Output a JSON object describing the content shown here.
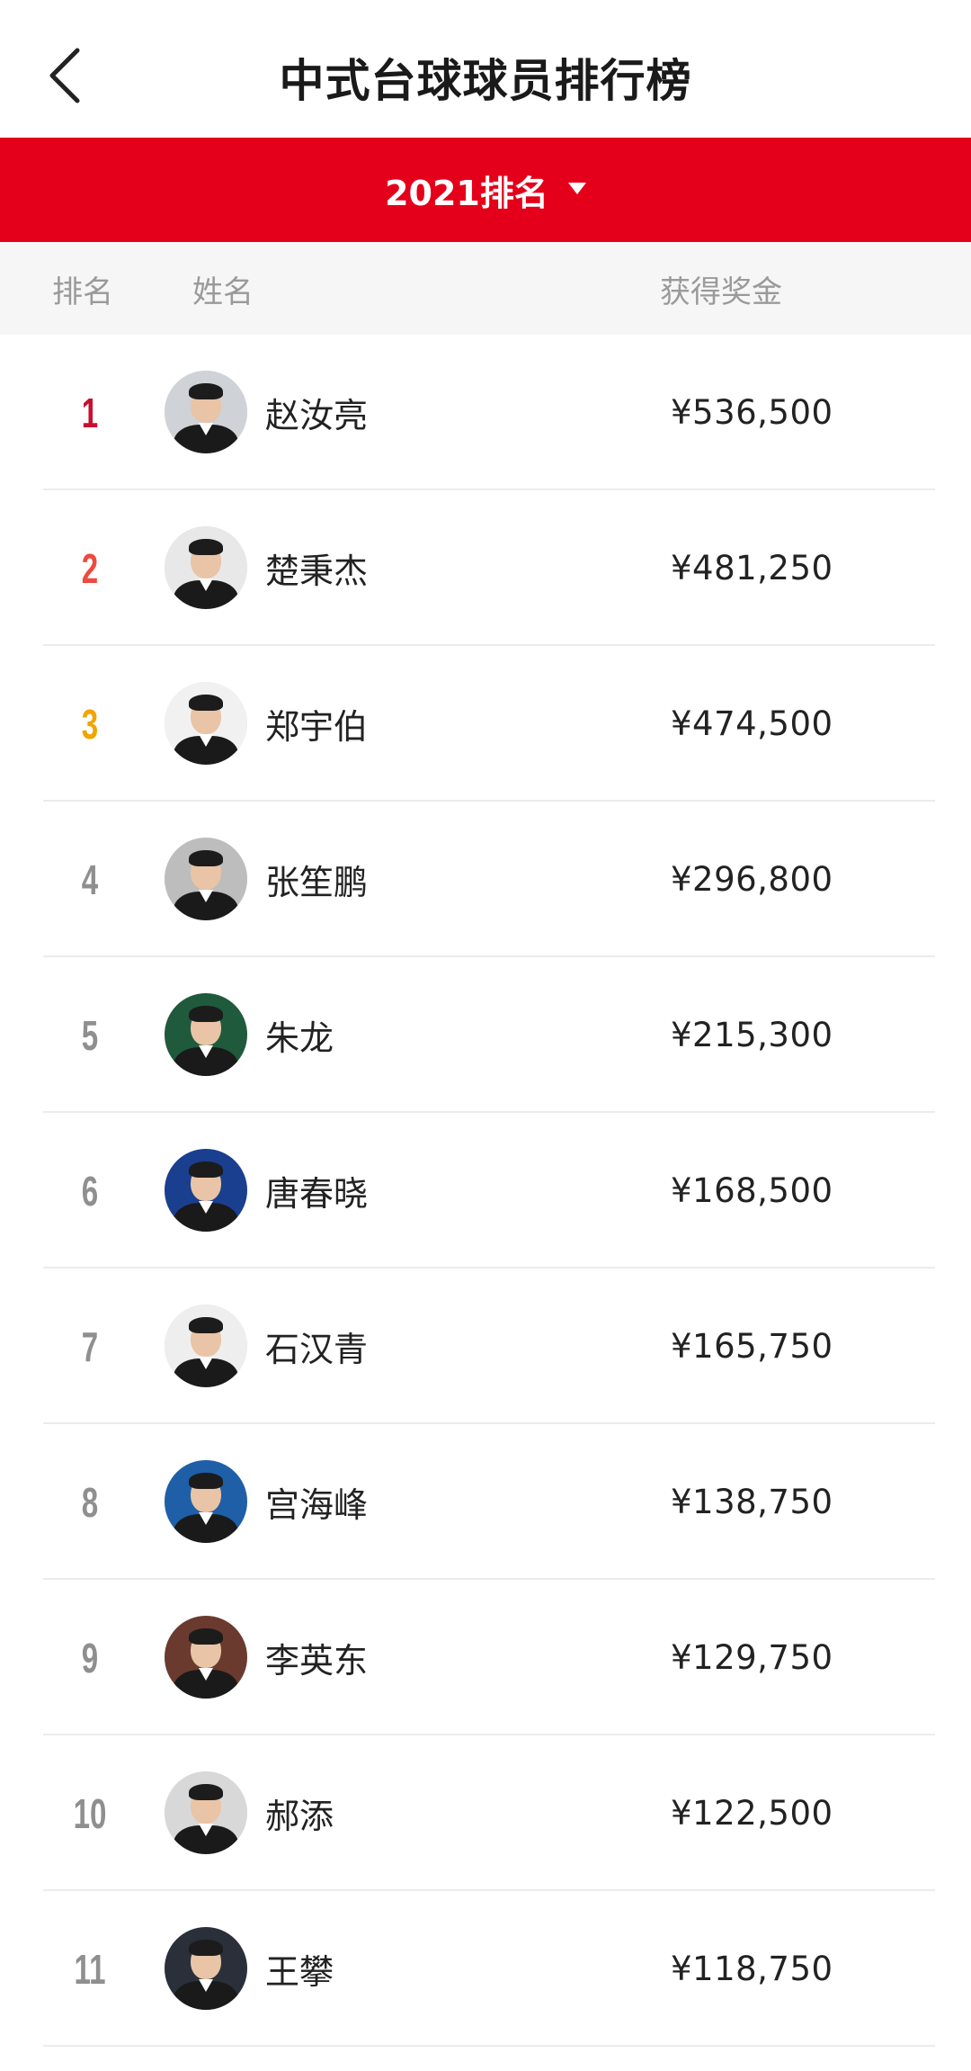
{
  "header": {
    "title": "中式台球球员排行榜"
  },
  "selector": {
    "label": "2021排名"
  },
  "columns": {
    "rank": "排名",
    "name": "姓名",
    "prize": "获得奖金"
  },
  "players": [
    {
      "rank": "1",
      "name": "赵汝亮",
      "prize": "¥536,500",
      "avatar_bg": "#cfd2d6"
    },
    {
      "rank": "2",
      "name": "楚秉杰",
      "prize": "¥481,250",
      "avatar_bg": "#e8e8e8"
    },
    {
      "rank": "3",
      "name": "郑宇伯",
      "prize": "¥474,500",
      "avatar_bg": "#f1f1f1"
    },
    {
      "rank": "4",
      "name": "张笙鹏",
      "prize": "¥296,800",
      "avatar_bg": "#bdbdbd"
    },
    {
      "rank": "5",
      "name": "朱龙",
      "prize": "¥215,300",
      "avatar_bg": "#1f5a3c"
    },
    {
      "rank": "6",
      "name": "唐春晓",
      "prize": "¥168,500",
      "avatar_bg": "#1b3f8f"
    },
    {
      "rank": "7",
      "name": "石汉青",
      "prize": "¥165,750",
      "avatar_bg": "#eeeeee"
    },
    {
      "rank": "8",
      "name": "宫海峰",
      "prize": "¥138,750",
      "avatar_bg": "#1e5fa8"
    },
    {
      "rank": "9",
      "name": "李英东",
      "prize": "¥129,750",
      "avatar_bg": "#6b3a2e"
    },
    {
      "rank": "10",
      "name": "郝添",
      "prize": "¥122,500",
      "avatar_bg": "#d8d8d8"
    },
    {
      "rank": "11",
      "name": "王攀",
      "prize": "¥118,750",
      "avatar_bg": "#2a2f3a"
    }
  ],
  "colors": {
    "accent": "#e4001b",
    "rank1": "#c8102e",
    "rank2": "#ee4a3d",
    "rank3": "#f0a500"
  }
}
